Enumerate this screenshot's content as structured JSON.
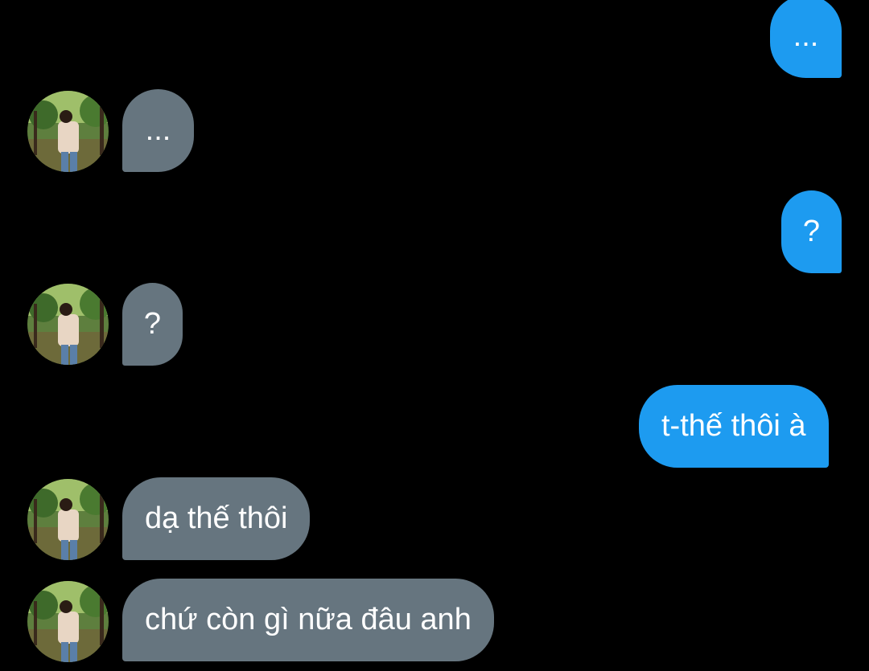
{
  "colors": {
    "background": "#000000",
    "outgoing_bubble": "#1d9bf0",
    "incoming_bubble": "#66757f",
    "text": "#ffffff"
  },
  "messages": [
    {
      "direction": "outgoing",
      "text": "..."
    },
    {
      "direction": "incoming",
      "text": "...",
      "avatar": "profile-photo-icon"
    },
    {
      "direction": "outgoing",
      "text": "?"
    },
    {
      "direction": "incoming",
      "text": "?",
      "avatar": "profile-photo-icon"
    },
    {
      "direction": "outgoing",
      "text": "t-thế thôi à"
    },
    {
      "direction": "incoming",
      "text": "dạ thế thôi",
      "avatar": "profile-photo-icon"
    },
    {
      "direction": "incoming",
      "text": "chứ còn gì nữa đâu anh",
      "avatar": "profile-photo-icon"
    }
  ]
}
